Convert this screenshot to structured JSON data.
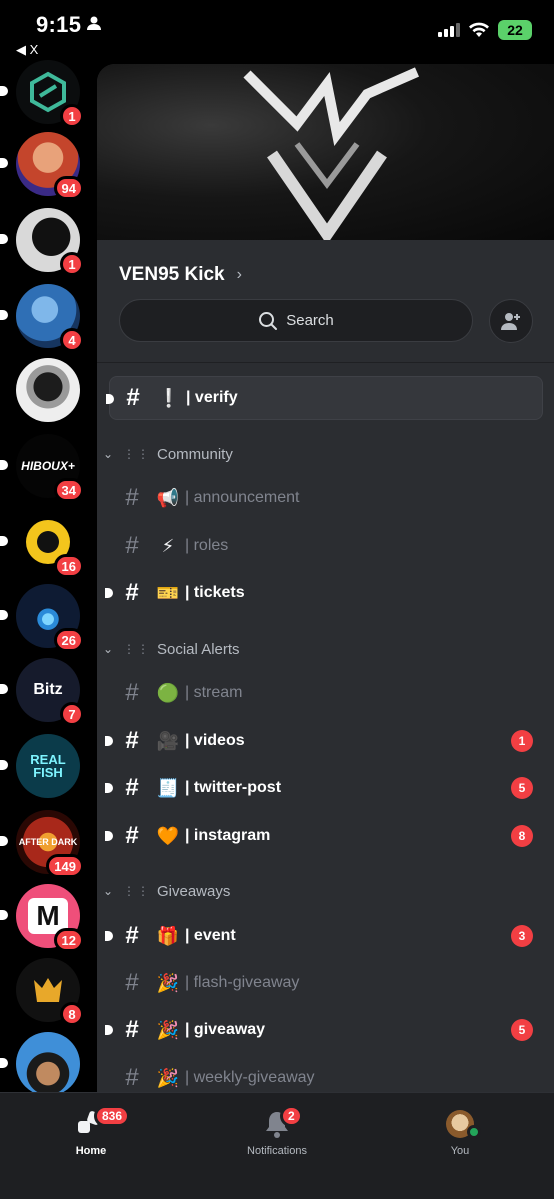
{
  "status_bar": {
    "time": "9:15",
    "back_label": "◀ X",
    "battery": "22"
  },
  "servers": [
    {
      "initials": "",
      "badge": "1",
      "bg": "#1d2a24"
    },
    {
      "initials": "",
      "badge": "94",
      "bg": "#c4452c"
    },
    {
      "initials": "",
      "badge": "1",
      "bg": "#d9d9d9"
    },
    {
      "initials": "",
      "badge": "4",
      "bg": "#2f6fb5"
    },
    {
      "initials": "",
      "badge": "",
      "bg": "#e6e6e6"
    },
    {
      "initials": "HIBOUX+",
      "badge": "34",
      "bg": "#050505"
    },
    {
      "initials": "",
      "badge": "16",
      "bg": "#f3c51c"
    },
    {
      "initials": "",
      "badge": "26",
      "bg": "#0e1b33"
    },
    {
      "initials": "Bitz",
      "badge": "7",
      "bg": "#161b2c"
    },
    {
      "initials": "REAL FISH",
      "badge": "",
      "bg": "#0b3b4a"
    },
    {
      "initials": "AFTER DARK",
      "badge": "149",
      "bg": "#7a1a10"
    },
    {
      "initials": "M",
      "badge": "12",
      "bg": "#ef4f7a"
    },
    {
      "initials": "",
      "badge": "8",
      "bg": "#111111"
    },
    {
      "initials": "",
      "badge": "",
      "bg": "#3f8fd8"
    }
  ],
  "server": {
    "name": "VEN95 Kick",
    "search_placeholder": "Search"
  },
  "channels": {
    "verify": {
      "emoji": "❕",
      "name": "| verify"
    },
    "community": "Community",
    "announcement": {
      "emoji": "📢",
      "name": "| announcement"
    },
    "roles": {
      "emoji": "⚡",
      "name": "| roles"
    },
    "tickets": {
      "emoji": "🎫",
      "name": "| tickets"
    },
    "social_alerts": "Social Alerts",
    "stream": {
      "emoji": "🟢",
      "name": "| stream"
    },
    "videos": {
      "emoji": "🎥",
      "name": "| videos",
      "badge": "1"
    },
    "twitter": {
      "emoji": "🧾",
      "name": "| twitter-post",
      "badge": "5"
    },
    "instagram": {
      "emoji": "🧡",
      "name": "| instagram",
      "badge": "8"
    },
    "giveaways": "Giveaways",
    "event": {
      "emoji": "🎁",
      "name": "| event",
      "badge": "3"
    },
    "flash": {
      "emoji": "🎉",
      "name": "| flash-giveaway"
    },
    "giveaway": {
      "emoji": "🎉",
      "name": "| giveaway",
      "badge": "5"
    },
    "weekly": {
      "emoji": "🎉",
      "name": "| weekly-giveaway"
    }
  },
  "tabs": {
    "home": {
      "label": "Home",
      "badge": "836"
    },
    "notifications": {
      "label": "Notifications",
      "badge": "2"
    },
    "you": {
      "label": "You"
    }
  }
}
